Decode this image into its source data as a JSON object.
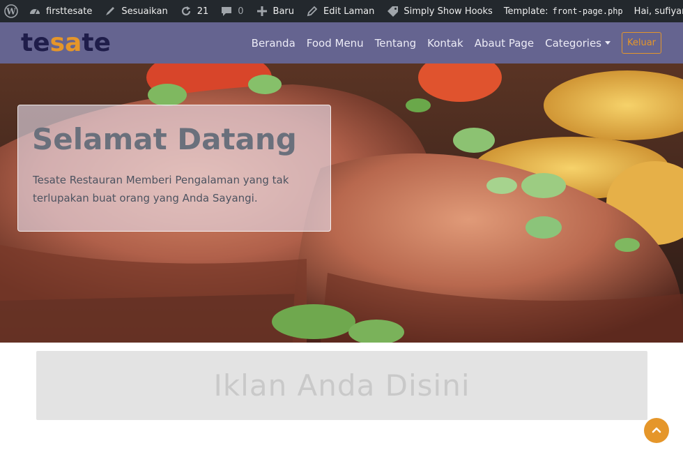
{
  "adminbar": {
    "site_name": "firsttesate",
    "customize": "Sesuaikan",
    "updates_count": "21",
    "comments_count": "0",
    "new_label": "Baru",
    "edit_label": "Edit Laman",
    "hooks_label": "Simply Show Hooks",
    "template_label": "Template:",
    "template_file": "front-page.php",
    "greeting": "Hai, sufiyan"
  },
  "brand": {
    "part1": "te",
    "part2": "sa",
    "part3": "te"
  },
  "nav": {
    "items": [
      "Beranda",
      "Food Menu",
      "Tentang",
      "Kontak",
      "Abaut Page",
      "Categories"
    ],
    "logout": "Keluar"
  },
  "hero": {
    "title": "Selamat Datang",
    "text": "Tesate Restauran Memberi Pengalaman yang tak terlupakan buat orang yang Anda Sayangi."
  },
  "ad": {
    "text": "Iklan Anda Disini"
  },
  "colors": {
    "navbar": "#656490",
    "accent": "#e5962a",
    "adminbar": "#23282d"
  },
  "icons": [
    "wordpress-icon",
    "dashboard-icon",
    "brush-icon",
    "refresh-icon",
    "comment-icon",
    "plus-icon",
    "pencil-icon",
    "tag-icon",
    "search-icon",
    "chevron-up-icon"
  ]
}
